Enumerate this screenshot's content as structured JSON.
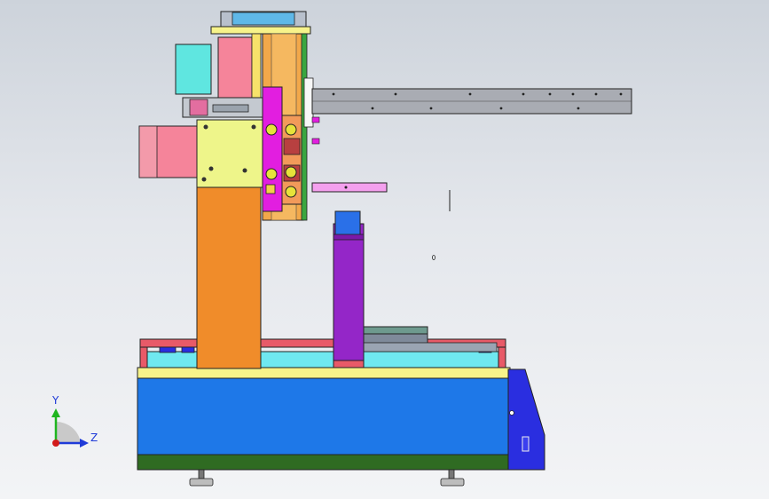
{
  "view": {
    "background_top": "#cdd3db",
    "background_bottom": "#f3f4f6"
  },
  "triad": {
    "y_label": "Y",
    "z_label": "Z",
    "y_color": "#1fb51f",
    "z_color": "#1f3bd8",
    "origin_color": "#d21b1b"
  },
  "colors": {
    "base_blue": "#1e78e8",
    "base_green": "#2f6b22",
    "base_yellow": "#f7f38a",
    "column_orange": "#f08c2a",
    "column_purple": "#9426c8",
    "motor_pink": "#f5849a",
    "motor_cyan": "#5fe6e0",
    "plate_yellow": "#eef58a",
    "slider_magenta": "#e21ee0",
    "rail_gray": "#a9acb3",
    "rail_red": "#e85a68",
    "cyan_strip": "#6fe8f0",
    "end_plate_blue": "#2a2ee0",
    "light_pink": "#f4a0ee"
  }
}
